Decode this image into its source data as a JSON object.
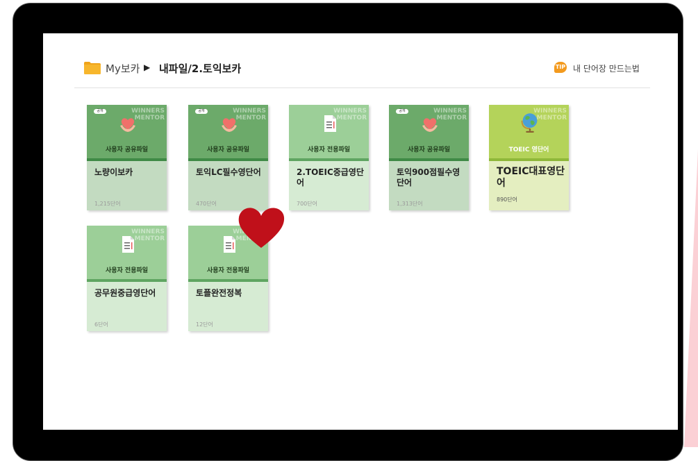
{
  "breadcrumb": {
    "root": "My보카",
    "path": "내파일/2.토익보카"
  },
  "tip": {
    "icon_label": "TIP",
    "link": "내 단어장 만드는법"
  },
  "cards": [
    {
      "category": "사용자 공유파일",
      "title": "노량이보카",
      "count": "1,215단어",
      "badge": "공개",
      "watermark": [
        "WINNERS",
        "MENTOR"
      ],
      "icon": "heart-hands-icon"
    },
    {
      "category": "사용자 공유파일",
      "title": "토익LC필수영단어",
      "count": "470단어",
      "badge": "공개",
      "watermark": [
        "WINNERS",
        "MENTOR"
      ],
      "icon": "heart-hands-icon"
    },
    {
      "category": "사용자 전용파일",
      "title": "2.TOEIC중급영단어",
      "count": "700단어",
      "watermark": [
        "WINNERS",
        "MENTOR"
      ],
      "icon": "document-icon"
    },
    {
      "category": "사용자 공유파일",
      "title": "토익900점필수영단어",
      "count": "1,313단어",
      "badge": "공개",
      "watermark": [
        "WINNERS",
        "MENTOR"
      ],
      "icon": "heart-hands-icon"
    },
    {
      "category": "TOEIC 영단어",
      "title": "TOEIC대표영단어",
      "count": "890단어",
      "watermark": [
        "WINNERS",
        "MENTOR"
      ],
      "icon": "globe-icon"
    },
    {
      "category": "사용자 전용파일",
      "title": "공무원중급영단어",
      "count": "6단어",
      "watermark": [
        "WINNERS",
        "MENTOR"
      ],
      "icon": "document-icon"
    },
    {
      "category": "사용자 전용파일",
      "title": "토플완전정복",
      "count": "12단어",
      "watermark": [
        "WINNERS",
        "MENTOR"
      ],
      "icon": "document-icon"
    }
  ],
  "colors": {
    "shared": "#6caa6a",
    "private": "#9ccf98",
    "toeic": "#b4d35a",
    "heart": "#c0101a",
    "tip": "#f39a1e"
  }
}
